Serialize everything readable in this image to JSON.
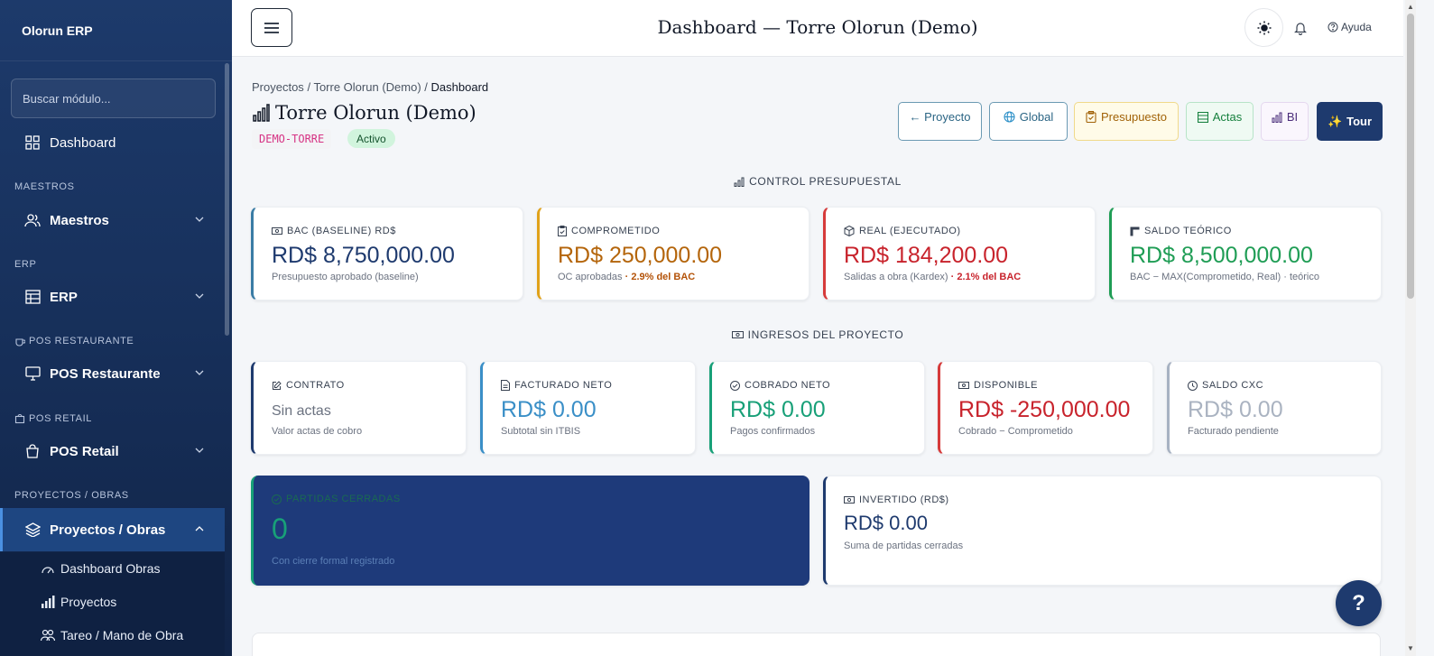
{
  "sidebar": {
    "brand": "Olorun ERP",
    "search_placeholder": "Buscar módulo...",
    "dashboard": "Dashboard",
    "sections": {
      "maestros": "MAESTROS",
      "erp": "ERP",
      "pos_restaurante": "POS RESTAURANTE",
      "pos_retail": "POS RETAIL",
      "proyectos": "PROYECTOS / OBRAS"
    },
    "items": {
      "maestros": "Maestros",
      "erp": "ERP",
      "pos_restaurante": "POS Restaurante",
      "pos_retail": "POS Retail",
      "proyectos": "Proyectos / Obras"
    },
    "sub_items": [
      "Dashboard Obras",
      "Proyectos",
      "Tareo / Mano de Obra"
    ]
  },
  "topbar": {
    "title": "Dashboard — Torre Olorun (Demo)",
    "help": "Ayuda"
  },
  "breadcrumb": {
    "p1": "Proyectos",
    "sep": "/",
    "p2": "Torre Olorun (Demo)",
    "p3": "Dashboard"
  },
  "project": {
    "title": "Torre Olorun (Demo)",
    "code": "DEMO-TORRE",
    "status": "Activo"
  },
  "actions": {
    "proyecto": "← Proyecto",
    "global": "Global",
    "presupuesto": "Presupuesto",
    "actas": "Actas",
    "bi": "BI",
    "tour": "Tour"
  },
  "control": {
    "title": "CONTROL PRESUPUESTAL",
    "bac": {
      "label": "BAC (BASELINE) RD$",
      "value": "RD$ 8,750,000.00",
      "sub": "Presupuesto aprobado (baseline)"
    },
    "comprometido": {
      "label": "COMPROMETIDO",
      "value": "RD$ 250,000.00",
      "sub": "OC aprobadas",
      "pct": "· 2.9% del BAC"
    },
    "real": {
      "label": "REAL (EJECUTADO)",
      "value": "RD$ 184,200.00",
      "sub": "Salidas a obra (Kardex)",
      "pct": "· 2.1% del BAC"
    },
    "saldo": {
      "label": "SALDO TEÓRICO",
      "value": "RD$ 8,500,000.00",
      "sub": "BAC − MAX(Comprometido, Real) · teórico"
    }
  },
  "ingresos": {
    "title": "INGRESOS DEL PROYECTO",
    "contrato": {
      "label": "CONTRATO",
      "value": "Sin actas",
      "sub": "Valor actas de cobro"
    },
    "facturado": {
      "label": "FACTURADO NETO",
      "value": "RD$ 0.00",
      "sub": "Subtotal sin ITBIS"
    },
    "cobrado": {
      "label": "COBRADO NETO",
      "value": "RD$ 0.00",
      "sub": "Pagos confirmados"
    },
    "disponible": {
      "label": "DISPONIBLE",
      "value": "RD$ -250,000.00",
      "sub": "Cobrado − Comprometido"
    },
    "saldo_cxc": {
      "label": "SALDO CXC",
      "value": "RD$ 0.00",
      "sub": "Facturado pendiente"
    }
  },
  "partidas": {
    "label": "PARTIDAS CERRADAS",
    "value": "0",
    "sub": "Con cierre formal registrado"
  },
  "invertido": {
    "label": "INVERTIDO (RD$)",
    "value": "RD$ 0.00",
    "sub": "Suma de partidas cerradas"
  },
  "fab": "?"
}
